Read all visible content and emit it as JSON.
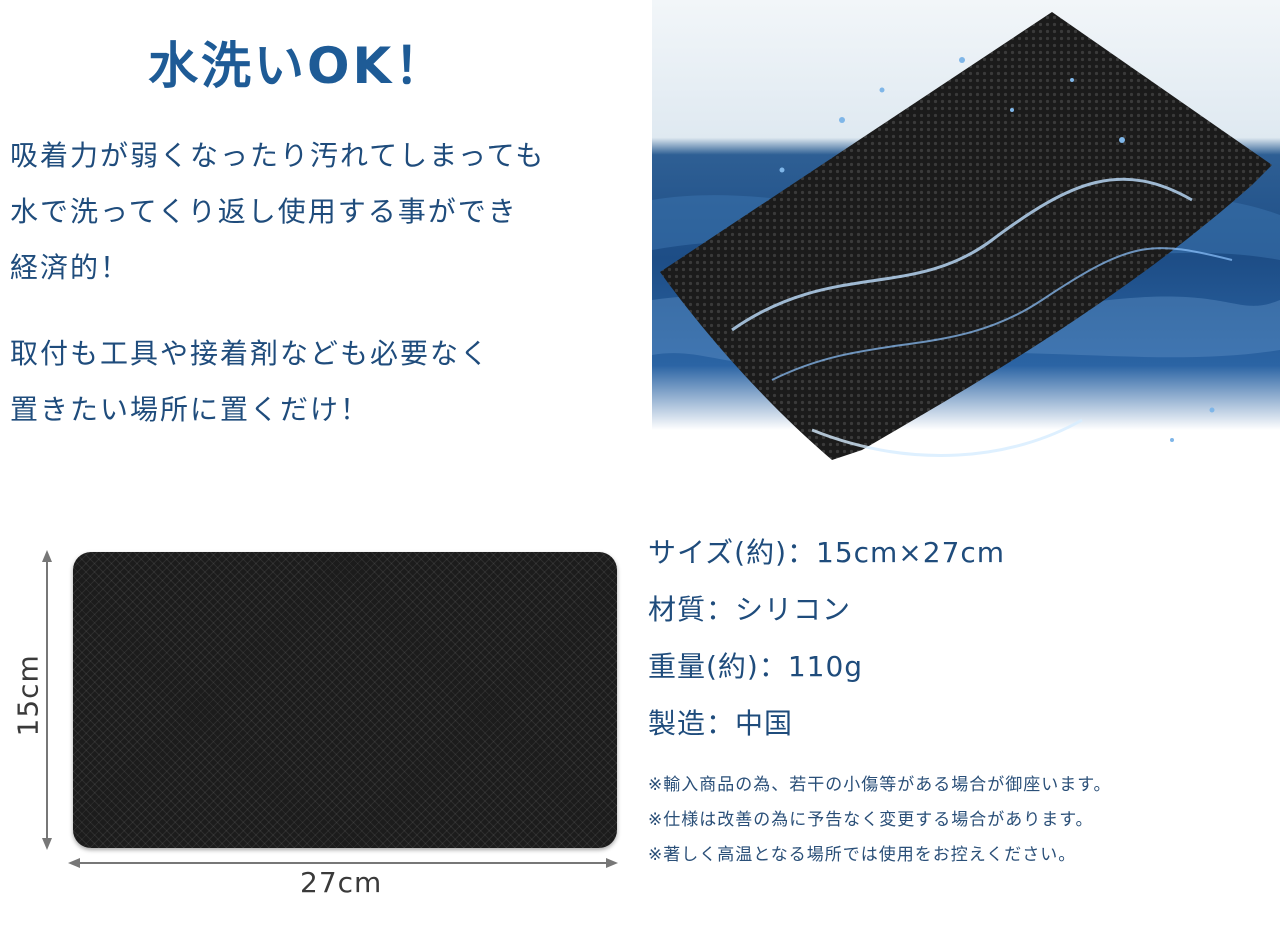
{
  "title": "水洗いOK！",
  "paragraph1": [
    "吸着力が弱くなったり汚れてしまっても",
    "水で洗ってくり返し使用する事ができ",
    "経済的！"
  ],
  "paragraph2": [
    "取付も工具や接着剤なども必要なく",
    "置きたい場所に置くだけ！"
  ],
  "dimensions": {
    "height_label": "15cm",
    "width_label": "27cm"
  },
  "specs": [
    "サイズ(約)：15cm×27cm",
    "材質：シリコン",
    "重量(約)：110g",
    "製造：中国"
  ],
  "notes": [
    "※輸入商品の為、若干の小傷等がある場合が御座います。",
    "※仕様は改善の為に予告なく変更する場合があります。",
    "※著しく高温となる場所では使用をお控えください。"
  ],
  "colors": {
    "heading": "#1e5b96",
    "body_text": "#1f4c7c",
    "mat": "#1c1c1c",
    "water": "#2a5f9a"
  }
}
